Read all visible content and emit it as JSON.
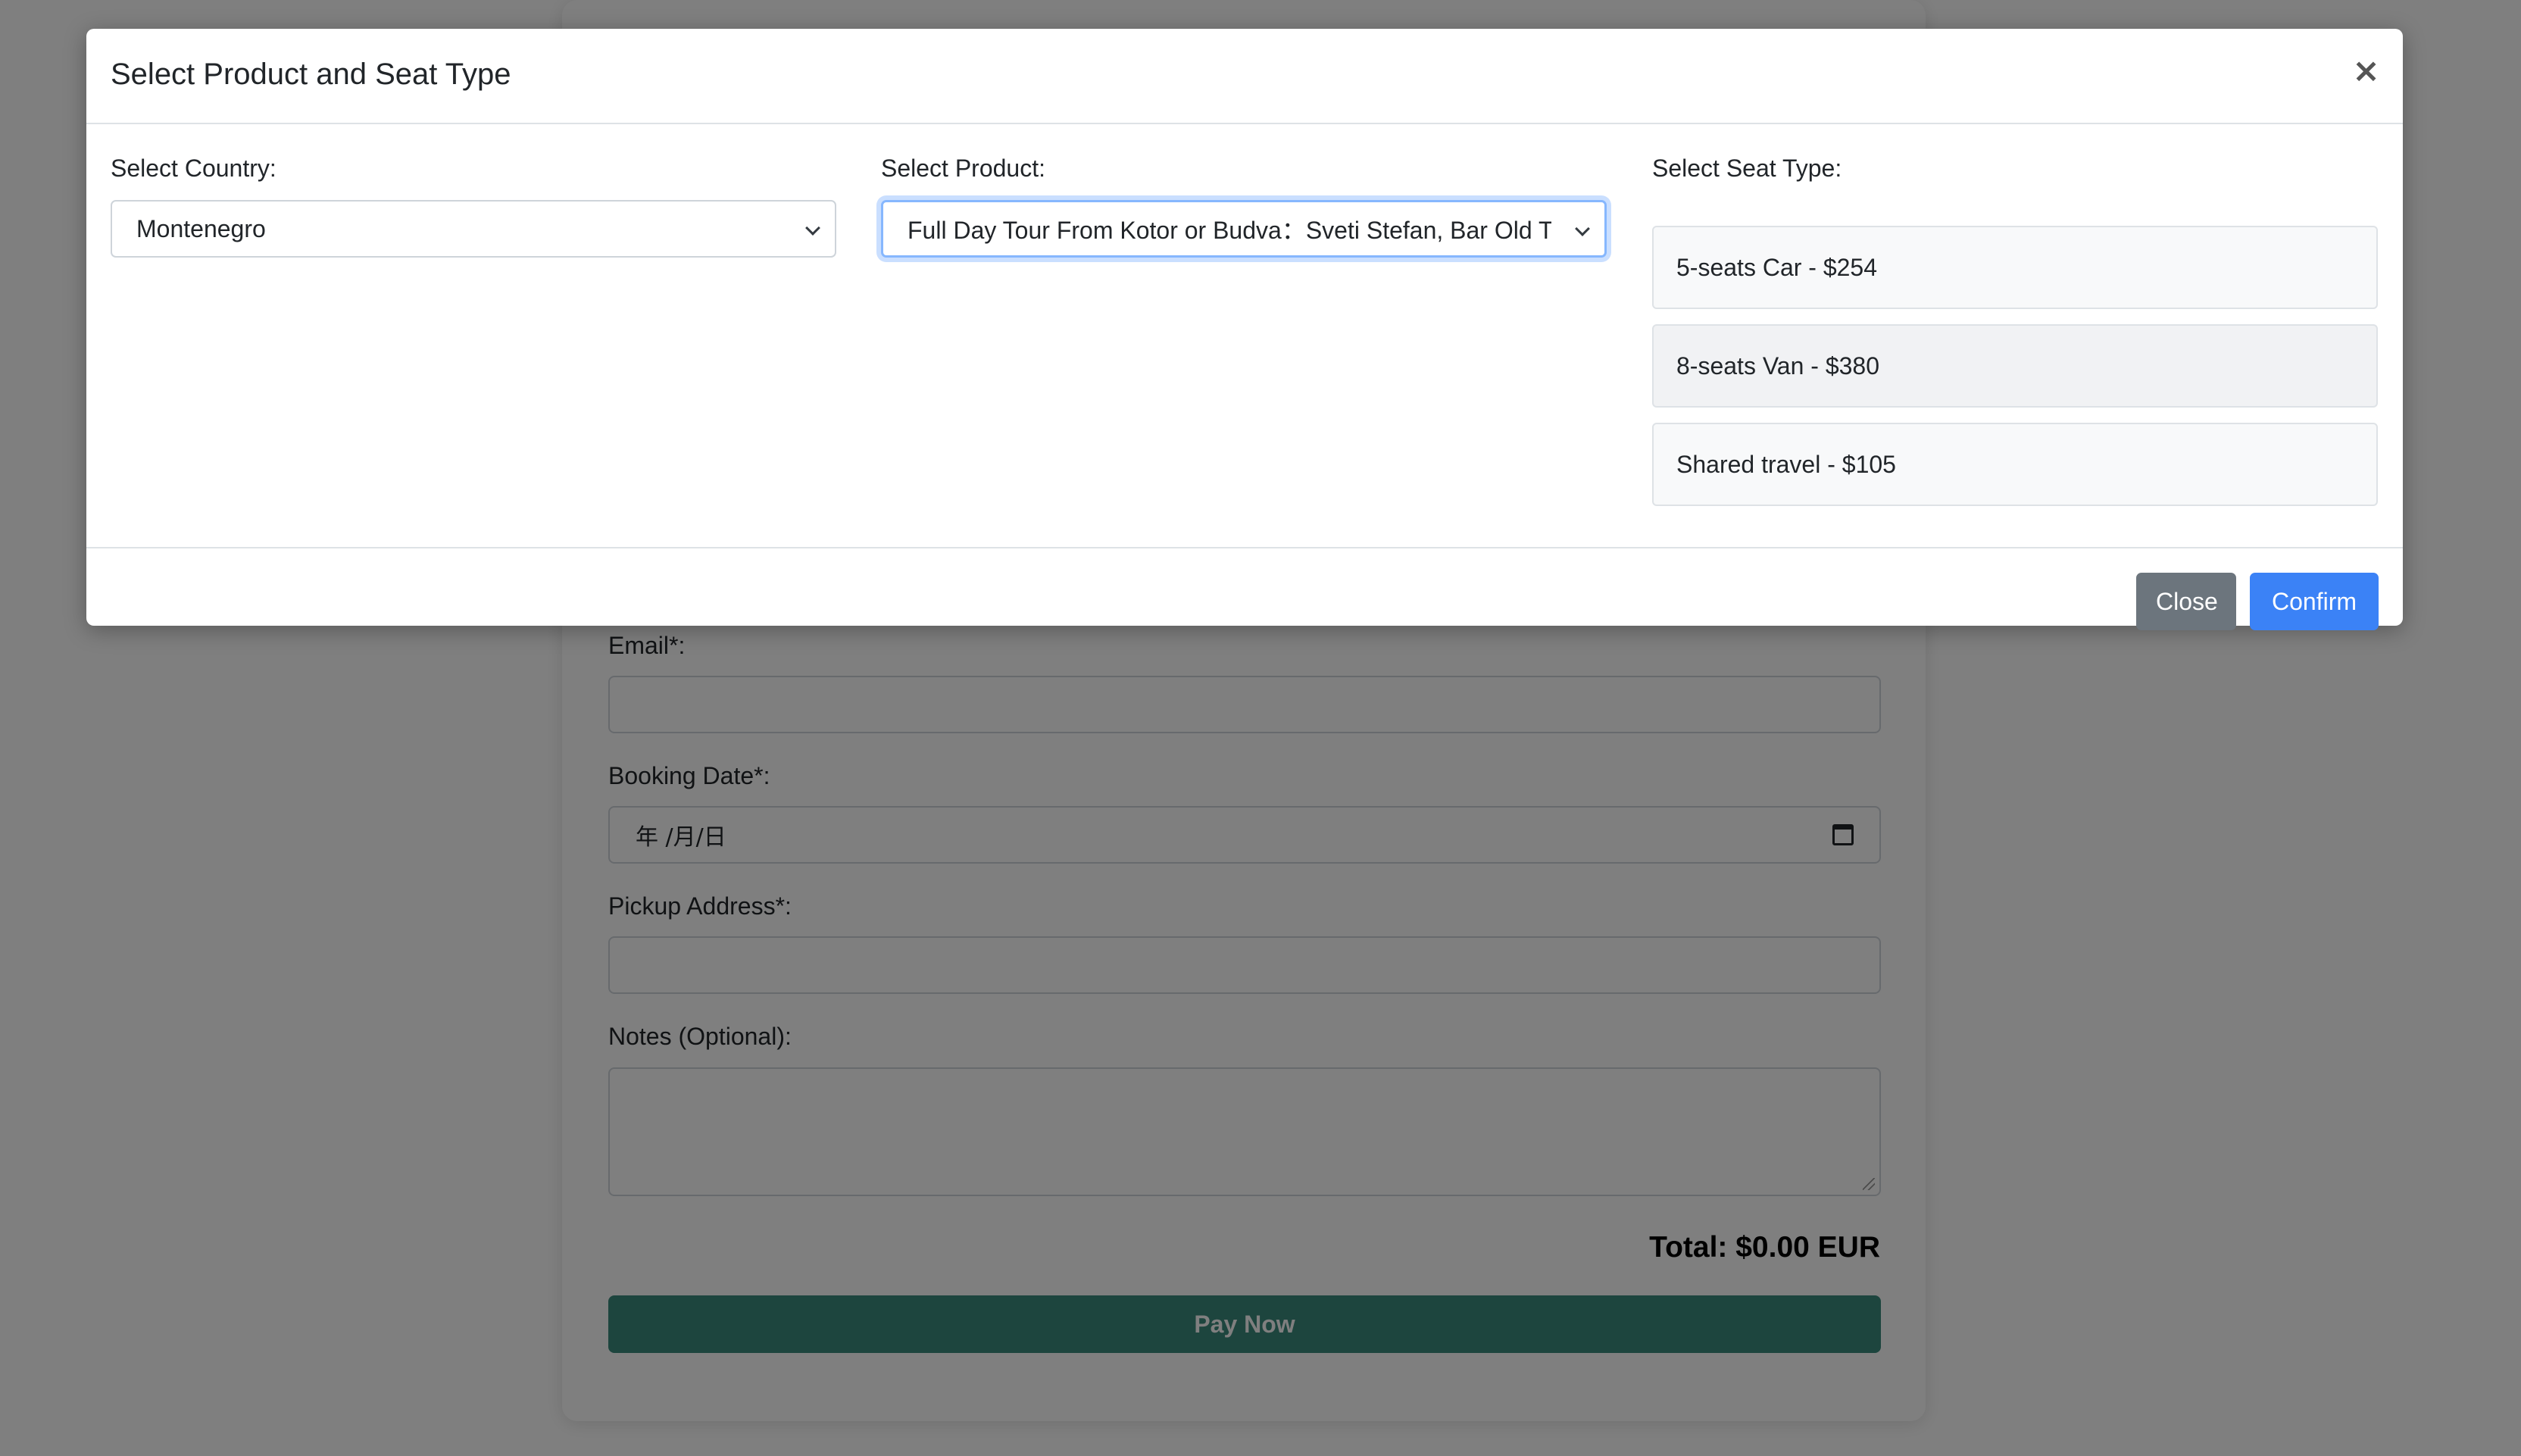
{
  "form": {
    "email_label": "Email*:",
    "booking_date_label": "Booking Date*:",
    "booking_date_placeholder": "年 /月/日",
    "pickup_label": "Pickup Address*:",
    "notes_label": "Notes (Optional):",
    "total": "Total: $0.00 EUR",
    "pay_button": "Pay Now"
  },
  "modal": {
    "title": "Select Product and Seat Type",
    "close_icon": "×",
    "country_label": "Select Country:",
    "country_value": "Montenegro",
    "product_label": "Select Product:",
    "product_value": "Full Day Tour From Kotor or Budva：Sveti Stefan, Bar Old Town, Ulcinj",
    "seat_label": "Select Seat Type:",
    "seat_options": [
      {
        "label": "5-seats Car - $254"
      },
      {
        "label": "8-seats Van - $380"
      },
      {
        "label": "Shared travel - $105"
      }
    ],
    "close_button": "Close",
    "confirm_button": "Confirm"
  },
  "colors": {
    "primary": "#3b82f6",
    "secondary": "#6c757d",
    "pay_button": "#3a8a7d",
    "backdrop": "rgba(0,0,0,0.5)"
  }
}
